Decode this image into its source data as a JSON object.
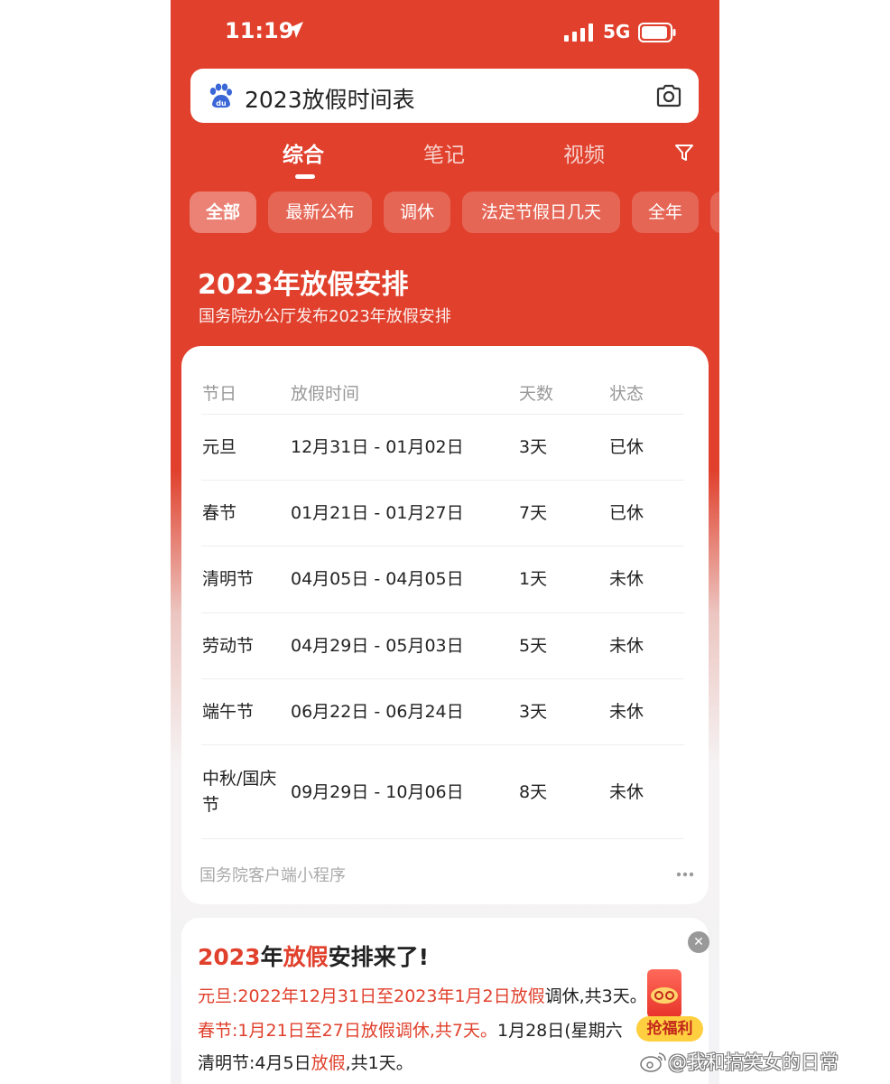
{
  "status_bar": {
    "time": "11:19",
    "network": "5G"
  },
  "search": {
    "query": "2023放假时间表"
  },
  "tabs": [
    {
      "label": "综合",
      "active": true
    },
    {
      "label": "笔记",
      "active": false
    },
    {
      "label": "视频",
      "active": false
    }
  ],
  "chips": [
    {
      "label": "全部",
      "active": true
    },
    {
      "label": "最新公布",
      "active": false
    },
    {
      "label": "调休",
      "active": false
    },
    {
      "label": "法定节假日几天",
      "active": false
    },
    {
      "label": "全年",
      "active": false
    }
  ],
  "section": {
    "title": "2023年放假安排",
    "subtitle": "国务院办公厅发布2023年放假安排"
  },
  "table": {
    "headers": [
      "节日",
      "放假时间",
      "天数",
      "状态"
    ],
    "rows": [
      {
        "holiday": "元旦",
        "period": "12月31日 - 01月02日",
        "days": "3天",
        "status": "已休"
      },
      {
        "holiday": "春节",
        "period": "01月21日 - 01月27日",
        "days": "7天",
        "status": "已休"
      },
      {
        "holiday": "清明节",
        "period": "04月05日 - 04月05日",
        "days": "1天",
        "status": "未休"
      },
      {
        "holiday": "劳动节",
        "period": "04月29日 - 05月03日",
        "days": "5天",
        "status": "未休"
      },
      {
        "holiday": "端午节",
        "period": "06月22日 - 06月24日",
        "days": "3天",
        "status": "未休"
      },
      {
        "holiday_line1": "中秋/国庆",
        "holiday_line2": "节",
        "period": "09月29日 - 10月06日",
        "days": "8天",
        "status": "未休"
      }
    ],
    "source": "国务院客户端小程序"
  },
  "article": {
    "title_parts": [
      "2023",
      "年",
      "放假",
      "安排来了!"
    ],
    "line1_parts": [
      "元旦:2022年12月31日至2023年1月2日放假",
      "调休,共3天。"
    ],
    "line2_parts": [
      "春节:1月21日至27日放假调休,共7天。",
      "1月28日(星期六"
    ],
    "line3_parts": [
      "清明节:4月5日",
      "放假",
      ",共1天。"
    ]
  },
  "promo": {
    "button_label": "抢福利"
  },
  "watermark": "@我和搞笑女的日常",
  "colors": {
    "brand_red": "#e0402c",
    "promo_yellow": "#ffcf3f"
  }
}
